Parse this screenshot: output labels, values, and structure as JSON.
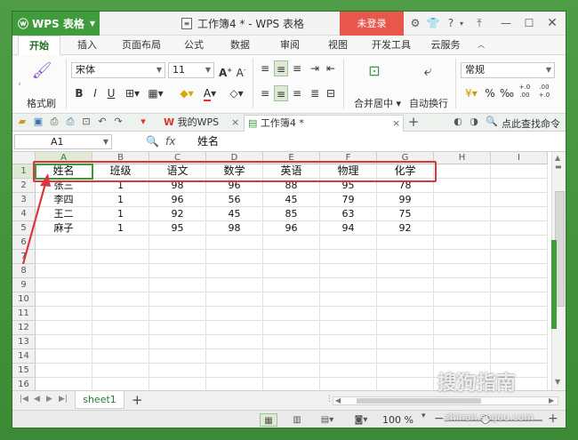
{
  "titlebar": {
    "app_name": "WPS 表格",
    "document_title": "工作簿4 * - WPS 表格",
    "login_label": "未登录",
    "help_label": "?"
  },
  "ribbon_tabs": [
    "开始",
    "插入",
    "页面布局",
    "公式",
    "数据",
    "审阅",
    "视图",
    "开发工具",
    "云服务"
  ],
  "ribbon": {
    "format_painter_label": "格式刷",
    "font_name": "宋体",
    "font_size": "11",
    "merge_label": "合并居中",
    "autowrap_label": "自动换行",
    "number_format": "常规",
    "bold": "B",
    "italic": "I",
    "underline": "U",
    "percent": "%",
    "thousands": "‰",
    "font_color_letter": "A",
    "font_grow": "A",
    "font_shrink": "A",
    "dec_inc": "+.0\n.00",
    "dec_dec": ".00\n+.0"
  },
  "docbar": {
    "tab1_label": "我的WPS",
    "tab2_label": "工作簿4 *",
    "search_label": "点此查找命令"
  },
  "formula_bar": {
    "name_box": "A1",
    "fx_label": "fx",
    "value": "姓名"
  },
  "grid": {
    "columns": [
      "A",
      "B",
      "C",
      "D",
      "E",
      "F",
      "G",
      "H",
      "I"
    ],
    "rows": [
      "1",
      "2",
      "3",
      "4",
      "5",
      "6",
      "7",
      "8",
      "9",
      "10",
      "11",
      "12",
      "13",
      "14",
      "15",
      "16"
    ],
    "header": [
      "姓名",
      "班级",
      "语文",
      "数学",
      "英语",
      "物理",
      "化学"
    ],
    "data": [
      [
        "张三",
        "1",
        "98",
        "96",
        "88",
        "95",
        "78"
      ],
      [
        "李四",
        "1",
        "96",
        "56",
        "45",
        "79",
        "99"
      ],
      [
        "王二",
        "1",
        "92",
        "45",
        "85",
        "63",
        "75"
      ],
      [
        "麻子",
        "1",
        "95",
        "98",
        "96",
        "94",
        "92"
      ]
    ]
  },
  "sheet_tabs": {
    "active": "sheet1",
    "add": "+"
  },
  "statusbar": {
    "zoom": "100 %",
    "zoom_minus": "−",
    "zoom_plus": "+",
    "zoom_level_percent": 100
  },
  "watermark": {
    "text": "搜狗指南",
    "url": "zhinan.sogou.com"
  },
  "colors": {
    "accent": "#3f9b3c",
    "login": "#e8574c",
    "annotation": "#d9363e",
    "wps_red": "#d7352b"
  }
}
